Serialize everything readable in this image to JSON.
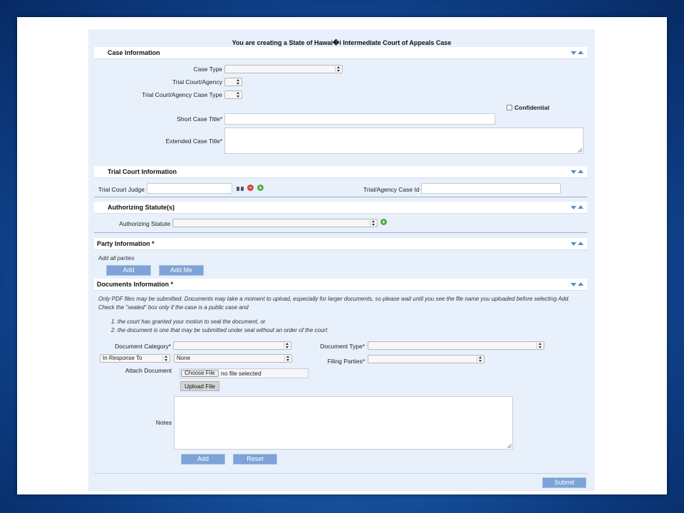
{
  "page": {
    "title": "You are creating a State of Hawai�i Intermediate Court of Appeals Case",
    "submit_label": "Submit"
  },
  "case_info": {
    "header": "Case Information",
    "case_type_label": "Case Type",
    "case_type_value": "",
    "trial_court_label": "Trial Court/Agency",
    "trial_court_value": "",
    "trial_court_case_type_label": "Trial Court/Agency Case Type",
    "trial_court_case_type_value": "",
    "confidential_label": "Confidential",
    "short_title_label": "Short Case Title*",
    "short_title_value": "",
    "extended_title_label": "Extended Case Title*",
    "extended_title_value": ""
  },
  "trial_court_info": {
    "header": "Trial Court Information",
    "judge_label": "Trial Court Judge",
    "judge_value": "",
    "case_id_label": "Trial/Agency Case Id",
    "case_id_value": ""
  },
  "statutes": {
    "header": "Authorizing Statute(s)",
    "statute_label": "Authorizing Statute",
    "statute_value": ""
  },
  "party_info": {
    "header": "Party Information *",
    "note": "Add all parties",
    "add_label": "Add",
    "add_me_label": "Add Me"
  },
  "documents": {
    "header": "Documents Information *",
    "instructions": "Only PDF files may be submitted. Documents may take a moment to upload, especially for larger documents, so please wait until you see the file name you uploaded before selecting Add. Check the \"sealed\" box only if the case is a public case and",
    "conditions": [
      "1.  the court has granted your motion to seal the document, or",
      "2.  the document is one that may be submitted under seal without an order of the court"
    ],
    "category_label": "Document Category*",
    "category_value": "",
    "type_label": "Document Type*",
    "type_value": "",
    "response_value": "In Response To",
    "none_value": "None",
    "filing_parties_label": "Filing Parties*",
    "filing_parties_value": "",
    "attach_label": "Attach Document",
    "choose_file_label": "Choose File",
    "no_file_text": "no file selected",
    "upload_label": "Upload File",
    "notes_label": "Notes",
    "notes_value": "",
    "add_label": "Add",
    "reset_label": "Reset"
  }
}
